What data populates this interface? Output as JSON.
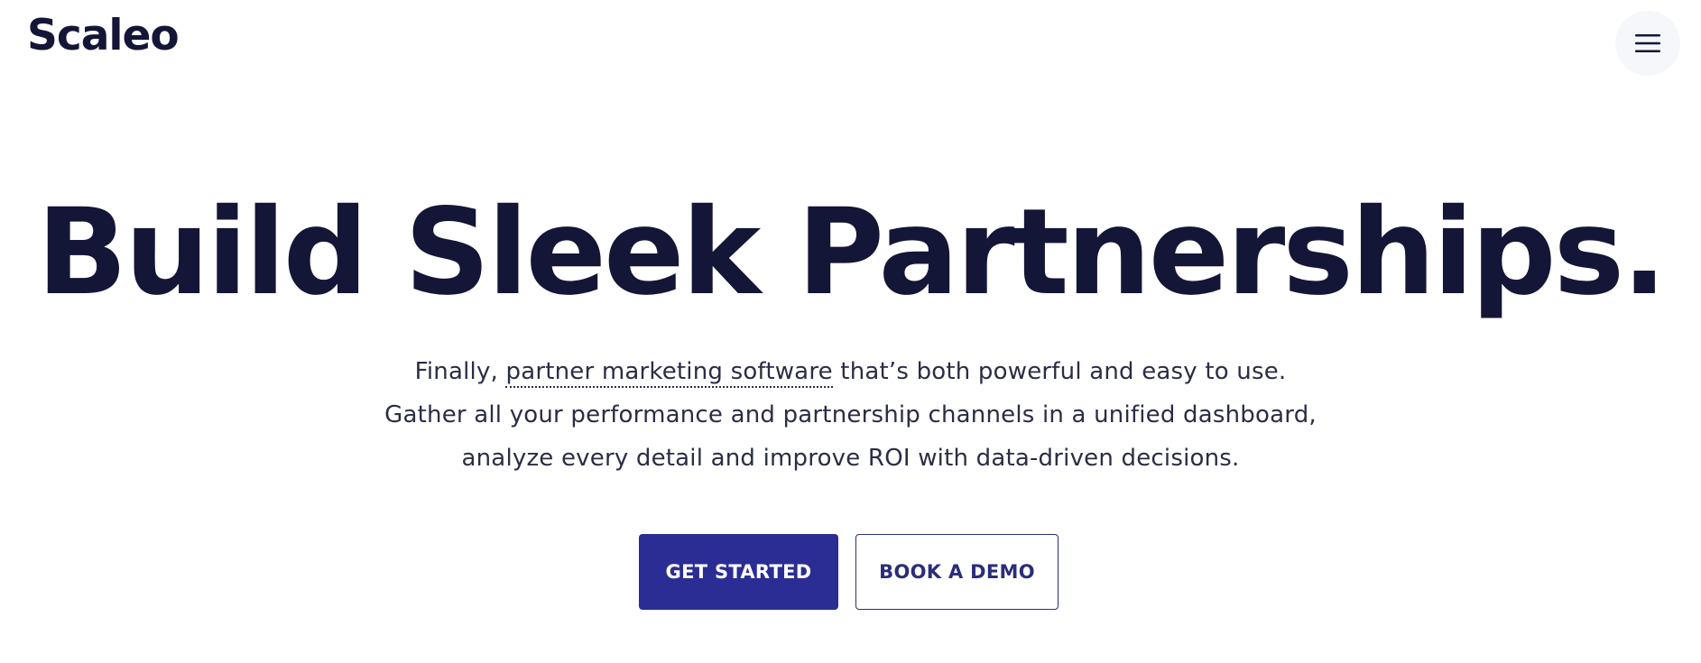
{
  "header": {
    "logo_text": "Scaleo",
    "menu_icon": "hamburger-menu-icon"
  },
  "hero": {
    "title": "Build Sleek Partnerships.",
    "subtitle": {
      "line1_before": "Finally, ",
      "line1_link": "partner marketing software",
      "line1_after": " that’s both powerful and easy to use.",
      "line2": "Gather all your performance and partnership channels in a unified dashboard,",
      "line3": "analyze every detail and improve ROI with data-driven decisions."
    },
    "primary_cta": "GET STARTED",
    "secondary_cta": "BOOK A DEMO"
  },
  "colors": {
    "text_dark": "#141637",
    "primary": "#2b2d94",
    "menu_bg": "#f6f7fb"
  }
}
